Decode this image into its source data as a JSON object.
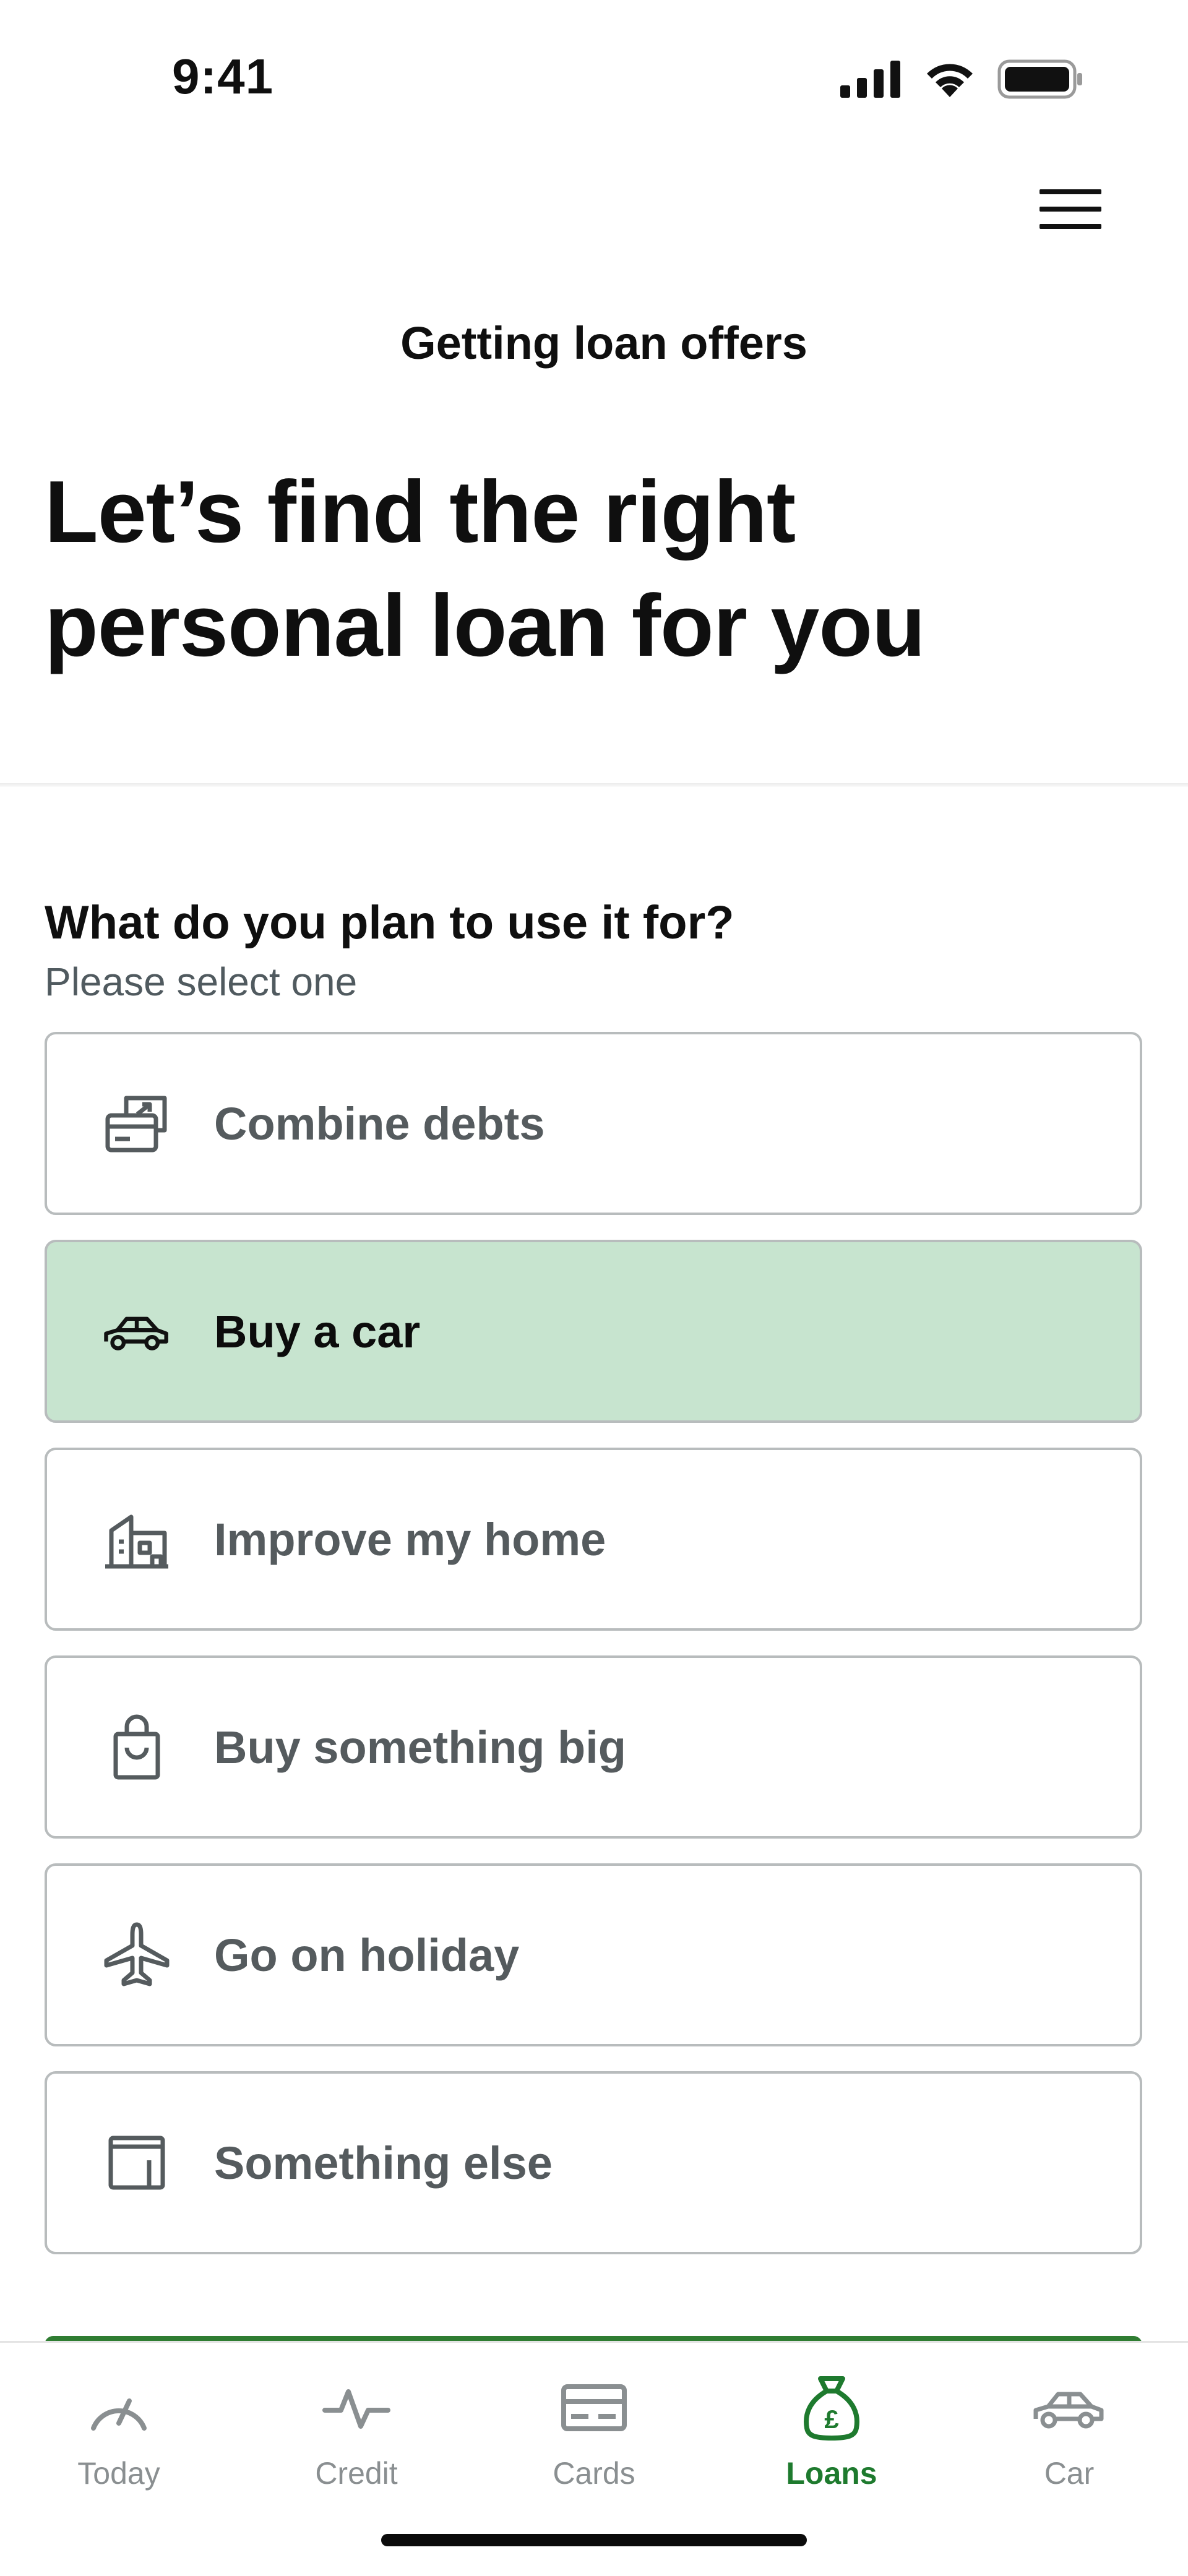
{
  "status_bar": {
    "time": "9:41",
    "icons": [
      "cellular-signal-icon",
      "wifi-icon",
      "battery-icon"
    ]
  },
  "header": {
    "menu_icon": "hamburger-menu-icon",
    "subtitle": "Getting loan offers",
    "title": "Let’s find the right personal loan for you"
  },
  "form": {
    "question": "What do you plan to use it for?",
    "hint": "Please select one",
    "options": [
      {
        "label": "Combine debts",
        "icon": "combine-debts-icon",
        "selected": false
      },
      {
        "label": "Buy a car",
        "icon": "car-icon",
        "selected": true
      },
      {
        "label": "Improve my home",
        "icon": "home-building-icon",
        "selected": false
      },
      {
        "label": "Buy something big",
        "icon": "shopping-bag-icon",
        "selected": false
      },
      {
        "label": "Go on holiday",
        "icon": "airplane-icon",
        "selected": false
      },
      {
        "label": "Something else",
        "icon": "wallet-icon",
        "selected": false
      }
    ]
  },
  "bottom_nav": {
    "items": [
      {
        "label": "Today",
        "icon": "gauge-icon",
        "active": false
      },
      {
        "label": "Credit",
        "icon": "pulse-icon",
        "active": false
      },
      {
        "label": "Cards",
        "icon": "card-icon",
        "active": false
      },
      {
        "label": "Loans",
        "icon": "money-bag-icon",
        "active": true
      },
      {
        "label": "Car",
        "icon": "car-icon",
        "active": false
      }
    ]
  },
  "colors": {
    "accent_green": "#1e7a2e",
    "selected_bg": "#c7e4cf",
    "border": "#b8bcbd",
    "muted_text": "#555b5e"
  }
}
